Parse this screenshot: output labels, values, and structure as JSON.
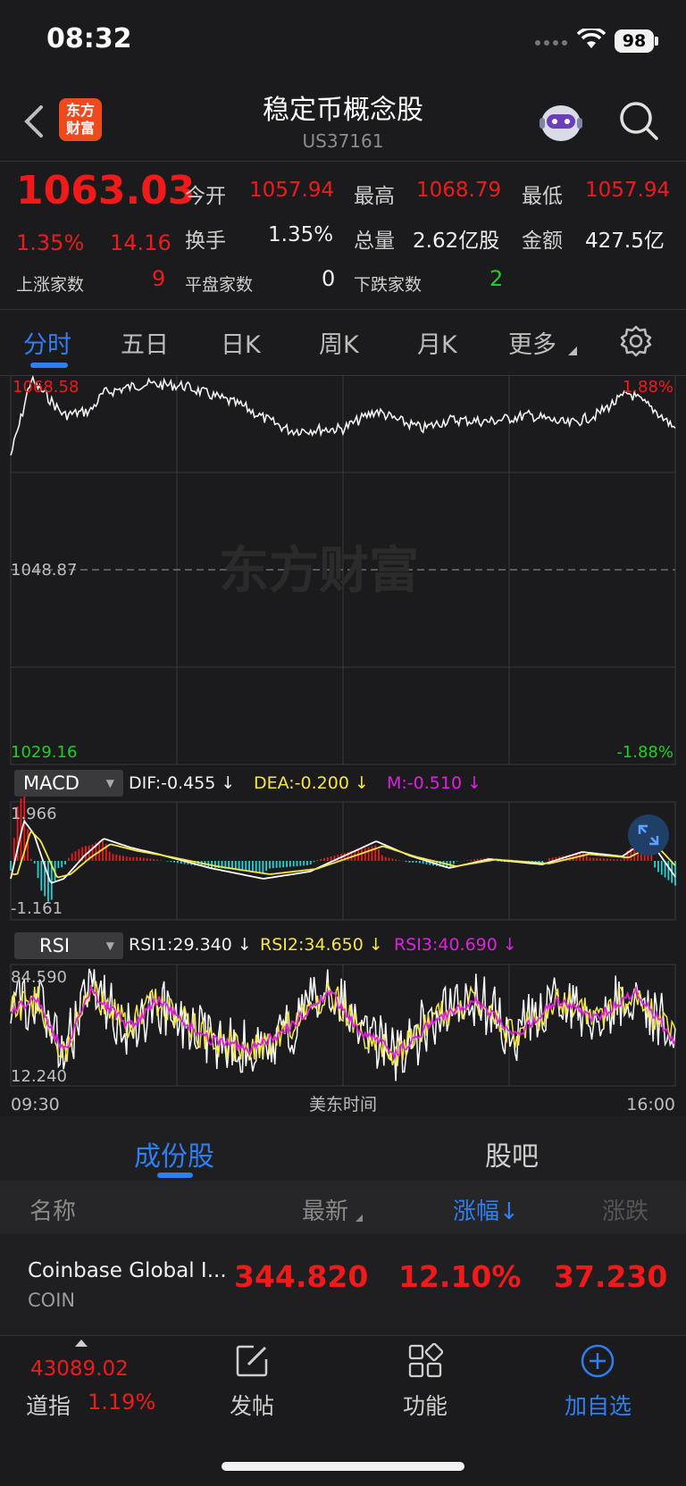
{
  "status_bar": {
    "time": "08:32",
    "battery": "98"
  },
  "nav": {
    "title": "稳定币概念股",
    "subtitle": "US37161",
    "logo_text_1": "东方",
    "logo_text_2": "财富"
  },
  "quote": {
    "price": "1063.03",
    "change_pct": "1.35%",
    "change_amt": "14.16",
    "open_label": "今开",
    "open": "1057.94",
    "high_label": "最高",
    "high": "1068.79",
    "low_label": "最低",
    "low": "1057.94",
    "turnover_label": "换手",
    "turnover": "1.35%",
    "volume_label": "总量",
    "volume": "2.62亿股",
    "amount_label": "金额",
    "amount": "427.5亿",
    "up_label": "上涨家数",
    "up_count": "9",
    "flat_label": "平盘家数",
    "flat_count": "0",
    "down_label": "下跌家数",
    "down_count": "2"
  },
  "tabs": [
    "分时",
    "五日",
    "日K",
    "周K",
    "月K",
    "更多"
  ],
  "intraday": {
    "high_label": "1068.58",
    "mid_label": "1048.87",
    "low_label": "1029.16",
    "pct_high": "1.88%",
    "pct_low": "-1.88%",
    "watermark": "东方财富",
    "time_start": "09:30",
    "time_mid": "美东时间",
    "time_end": "16:00"
  },
  "macd": {
    "name": "MACD",
    "dif": "DIF:-0.455 ↓",
    "dea": "DEA:-0.200 ↓",
    "m": "M:-0.510 ↓",
    "top": "1.966",
    "bottom": "-1.161"
  },
  "rsi": {
    "name": "RSI",
    "rsi1": "RSI1:29.340 ↓",
    "rsi2": "RSI2:34.650 ↓",
    "rsi3": "RSI3:40.690 ↓",
    "top": "84.590",
    "bottom": "12.240"
  },
  "constituents": {
    "tab_active": "成份股",
    "tab_other": "股吧",
    "col_name": "名称",
    "col_latest": "最新",
    "col_pct": "涨幅↓",
    "col_change": "涨跌",
    "rows": [
      {
        "name": "Coinbase Global I...",
        "code": "COIN",
        "latest": "344.820",
        "pct": "12.10%",
        "change": "37.230"
      }
    ]
  },
  "bottom": {
    "index_value": "43089.02",
    "index_name": "道指",
    "index_pct": "1.19%",
    "post": "发帖",
    "func": "功能",
    "add": "加自选"
  },
  "colors": {
    "up": "#f11a1a",
    "down": "#1ed11e",
    "accent": "#2f7ef2",
    "bg": "#1b1b1d"
  }
}
